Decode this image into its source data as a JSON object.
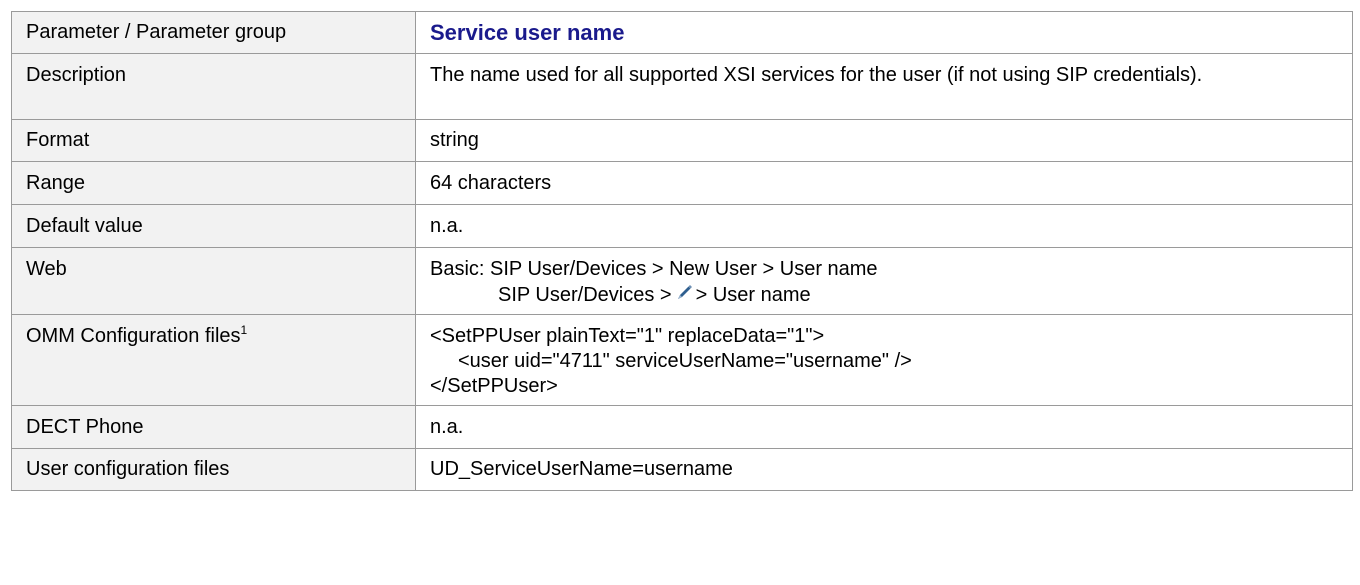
{
  "rows": [
    {
      "label": "Parameter / Parameter group",
      "value": "Service user name"
    },
    {
      "label": "Description",
      "value": "The name used for all supported XSI services for the user (if not using SIP credentials)."
    },
    {
      "label": "Format",
      "value": "string"
    },
    {
      "label": "Range",
      "value": "64 characters"
    },
    {
      "label": "Default value",
      "value": "n.a."
    },
    {
      "label": "Web",
      "line1": "Basic: SIP User/Devices > New User > User name",
      "line2_before": "SIP User/Devices >",
      "line2_after": "> User name",
      "icon": "edit-pencil-icon"
    },
    {
      "label": "OMM Configuration files",
      "footnote": "1",
      "line1": "<SetPPUser plainText=\"1\" replaceData=\"1\">",
      "line2": "<user uid=\"4711\" serviceUserName=\"username\" />",
      "line3": "</SetPPUser>"
    },
    {
      "label": "DECT Phone",
      "value": "n.a."
    },
    {
      "label": "User configuration files",
      "value": "UD_ServiceUserName=username"
    }
  ],
  "colors": {
    "title": "#1a1a8c",
    "label_bg": "#f2f2f2",
    "border": "#9a9a9a",
    "icon": "#2f5f8f"
  }
}
